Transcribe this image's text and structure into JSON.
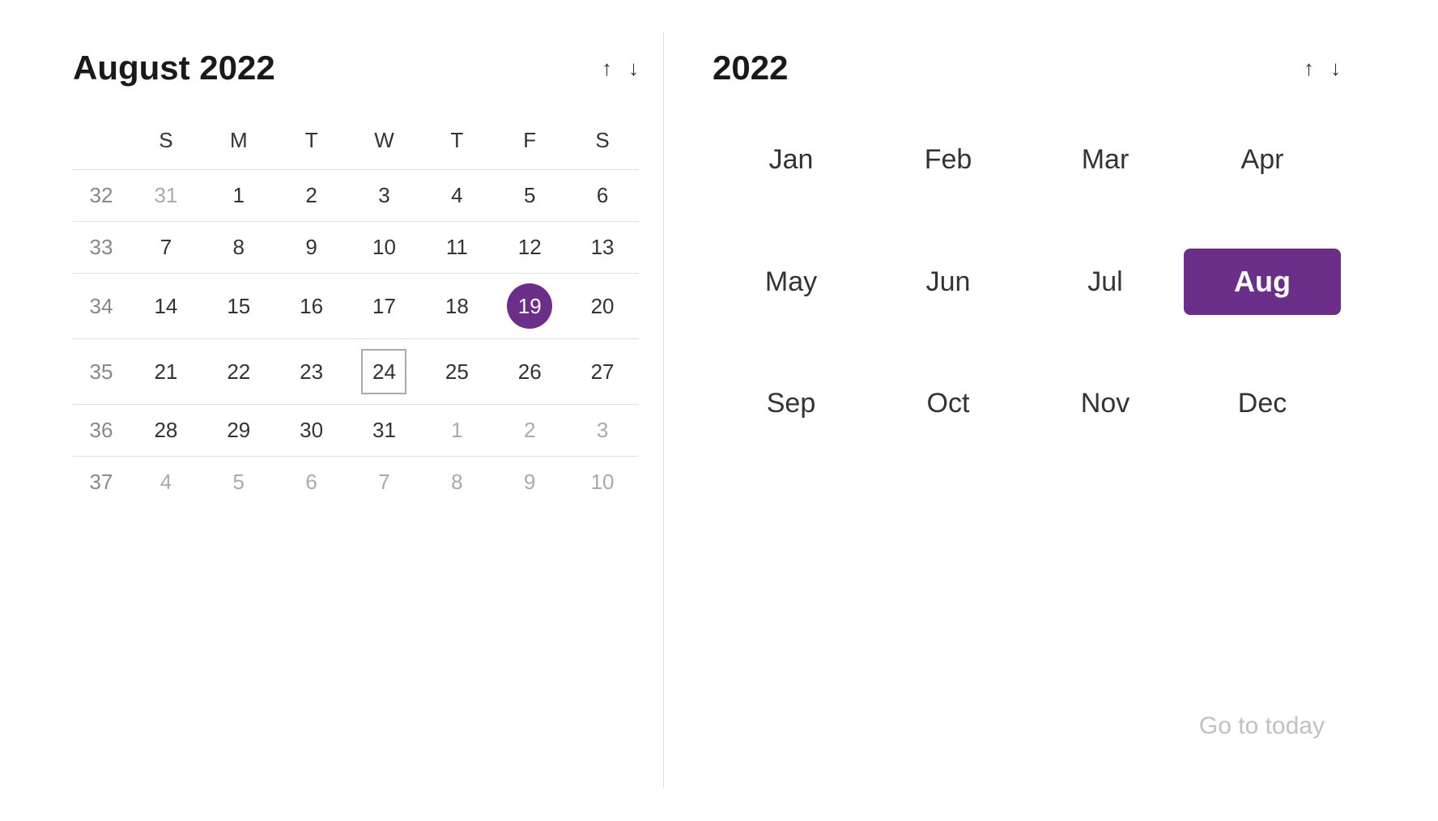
{
  "leftPanel": {
    "title": "August 2022",
    "dayHeaders": [
      "S",
      "M",
      "T",
      "W",
      "T",
      "F",
      "S"
    ],
    "weeks": [
      {
        "weekNum": 32,
        "days": [
          {
            "label": "31",
            "otherMonth": true
          },
          {
            "label": "1"
          },
          {
            "label": "2"
          },
          {
            "label": "3"
          },
          {
            "label": "4"
          },
          {
            "label": "5"
          },
          {
            "label": "6"
          }
        ]
      },
      {
        "weekNum": 33,
        "days": [
          {
            "label": "7"
          },
          {
            "label": "8"
          },
          {
            "label": "9"
          },
          {
            "label": "10"
          },
          {
            "label": "11"
          },
          {
            "label": "12"
          },
          {
            "label": "13"
          }
        ]
      },
      {
        "weekNum": 34,
        "days": [
          {
            "label": "14"
          },
          {
            "label": "15"
          },
          {
            "label": "16"
          },
          {
            "label": "17"
          },
          {
            "label": "18"
          },
          {
            "label": "19",
            "selected": true
          },
          {
            "label": "20"
          }
        ]
      },
      {
        "weekNum": 35,
        "days": [
          {
            "label": "21"
          },
          {
            "label": "22"
          },
          {
            "label": "23"
          },
          {
            "label": "24",
            "todayOutline": true
          },
          {
            "label": "25"
          },
          {
            "label": "26"
          },
          {
            "label": "27"
          }
        ]
      },
      {
        "weekNum": 36,
        "days": [
          {
            "label": "28"
          },
          {
            "label": "29"
          },
          {
            "label": "30"
          },
          {
            "label": "31"
          },
          {
            "label": "1",
            "otherMonth": true
          },
          {
            "label": "2",
            "otherMonth": true
          },
          {
            "label": "3",
            "otherMonth": true
          }
        ]
      },
      {
        "weekNum": 37,
        "days": [
          {
            "label": "4",
            "otherMonth": true
          },
          {
            "label": "5",
            "otherMonth": true
          },
          {
            "label": "6",
            "otherMonth": true
          },
          {
            "label": "7",
            "otherMonth": true
          },
          {
            "label": "8",
            "otherMonth": true
          },
          {
            "label": "9",
            "otherMonth": true
          },
          {
            "label": "10",
            "otherMonth": true
          }
        ]
      }
    ],
    "upArrow": "↑",
    "downArrow": "↓"
  },
  "rightPanel": {
    "title": "2022",
    "upArrow": "↑",
    "downArrow": "↓",
    "months": [
      {
        "label": "Jan",
        "active": false
      },
      {
        "label": "Feb",
        "active": false
      },
      {
        "label": "Mar",
        "active": false
      },
      {
        "label": "Apr",
        "active": false
      },
      {
        "label": "May",
        "active": false
      },
      {
        "label": "Jun",
        "active": false
      },
      {
        "label": "Jul",
        "active": false
      },
      {
        "label": "Aug",
        "active": true
      },
      {
        "label": "Sep",
        "active": false
      },
      {
        "label": "Oct",
        "active": false
      },
      {
        "label": "Nov",
        "active": false
      },
      {
        "label": "Dec",
        "active": false
      }
    ],
    "goToToday": "Go to today"
  }
}
